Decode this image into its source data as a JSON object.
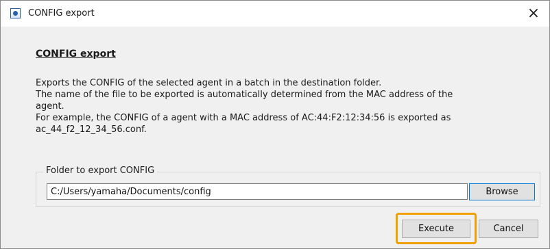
{
  "window": {
    "title": "CONFIG export",
    "close_glyph": "×",
    "app_icon": "app-icon"
  },
  "content": {
    "heading": "CONFIG export",
    "description_lines": [
      "Exports the CONFIG of the selected agent in a batch in the destination folder.",
      "The name of the file to be exported is automatically determined from the MAC address of the",
      "agent.",
      "For example, the CONFIG of a agent with a MAC address of AC:44:F2:12:34:56 is exported as",
      "ac_44_f2_12_34_56.conf."
    ]
  },
  "folder_group": {
    "legend": "Folder to export CONFIG",
    "path_value": "C:/Users/yamaha/Documents/config",
    "browse_label": "Browse"
  },
  "actions": {
    "execute_label": "Execute",
    "cancel_label": "Cancel",
    "highlight_color": "#f0a000"
  }
}
